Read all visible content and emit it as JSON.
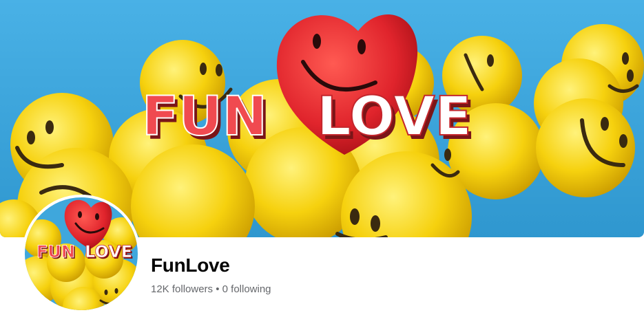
{
  "cover": {
    "banner_text_part1": "FUN",
    "banner_text_part2": "LOVE"
  },
  "avatar": {
    "text_part1": "FUN",
    "text_part2": "LOVE"
  },
  "profile": {
    "name": "FunLove",
    "followers": "12K followers",
    "separator": " • ",
    "following": "0 following"
  },
  "colors": {
    "sky": "#3fa7dc",
    "ball": "#f6d10e",
    "heart": "#e0242c",
    "text_dark": "#050505",
    "text_muted": "#65676b"
  }
}
